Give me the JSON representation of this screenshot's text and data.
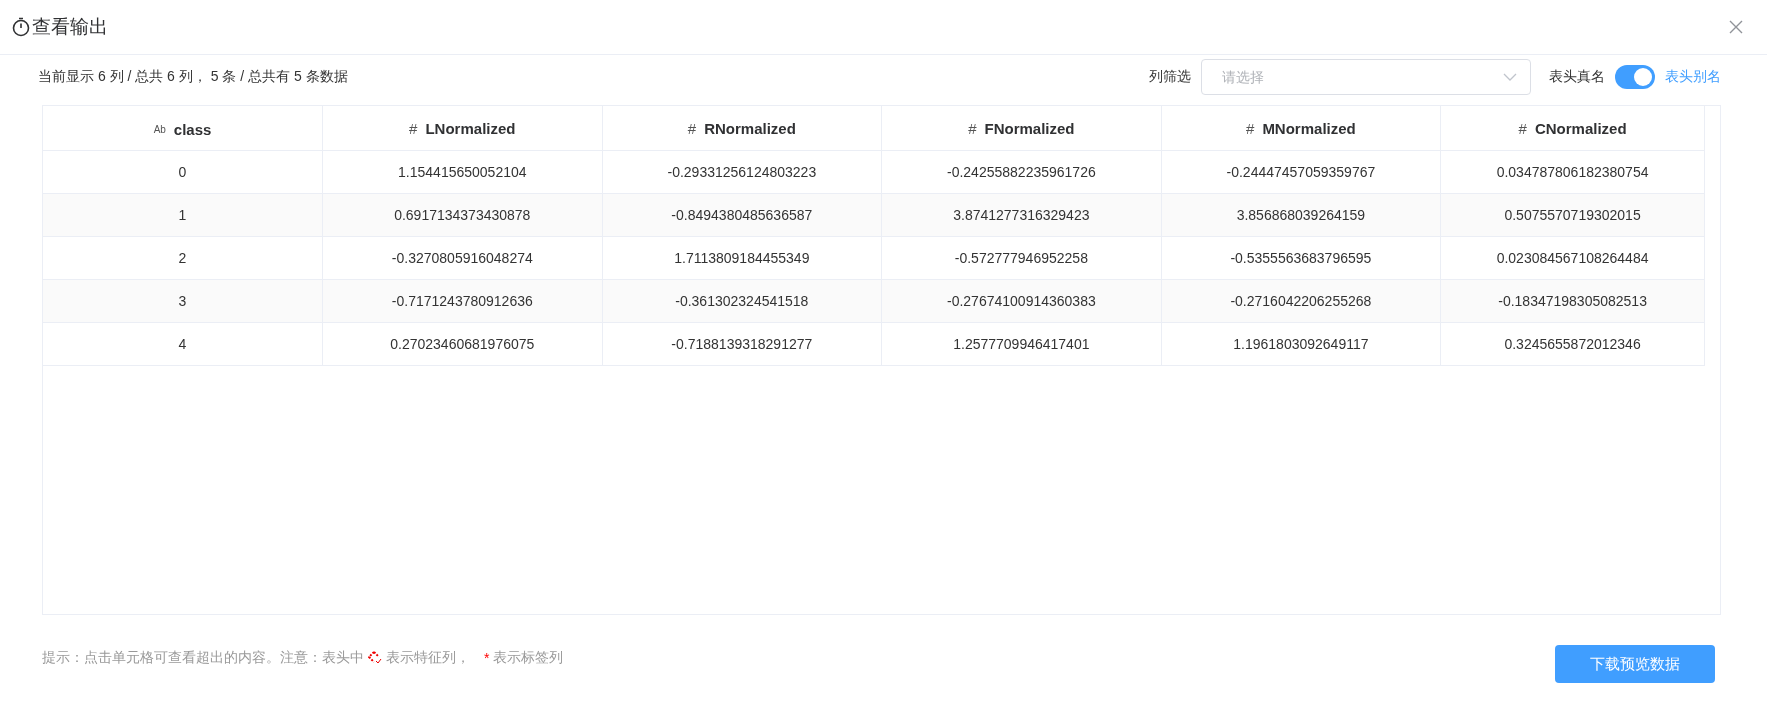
{
  "window": {
    "title": "查看输出"
  },
  "summary": "当前显示 6 列 / 总共 6 列， 5 条 / 总共有 5 条数据",
  "filter": {
    "label": "列筛选",
    "placeholder": "请选择"
  },
  "header_toggle": {
    "label": "表头真名",
    "on": true,
    "alt_label": "表头别名"
  },
  "table": {
    "columns": [
      {
        "icon": "Ab",
        "name": "class"
      },
      {
        "icon": "#",
        "name": "LNormalized"
      },
      {
        "icon": "#",
        "name": "RNormalized"
      },
      {
        "icon": "#",
        "name": "FNormalized"
      },
      {
        "icon": "#",
        "name": "MNormalized"
      },
      {
        "icon": "#",
        "name": "CNormalized"
      }
    ],
    "rows": [
      [
        "0",
        "1.154415650052104",
        "-0.29331256124803223",
        "-0.24255882235961726",
        "-0.24447457059359767",
        "0.034787806182380754"
      ],
      [
        "1",
        "0.6917134373430878",
        "-0.8494380485636587",
        "3.8741277316329423",
        "3.856868039264159",
        "0.5075570719302015"
      ],
      [
        "2",
        "-0.3270805916048274",
        "1.7113809184455349",
        "-0.572777946952258",
        "-0.5355563683796595",
        "0.023084567108264484"
      ],
      [
        "3",
        "-0.7171243780912636",
        "-0.361302324541518",
        "-0.27674100914360383",
        "-0.2716042206255268",
        "-0.18347198305082513"
      ],
      [
        "4",
        "0.27023460681976075",
        "-0.7188139318291277",
        "1.2577709946417401",
        "1.1961803092649117",
        "0.3245655872012346"
      ]
    ]
  },
  "hint": {
    "before": "提示：点击单元格可查看超出的内容。注意：表头中",
    "feature_text": "表示特征列，",
    "label_mark": "*",
    "label_text": "表示标签列"
  },
  "download_button": "下载预览数据"
}
